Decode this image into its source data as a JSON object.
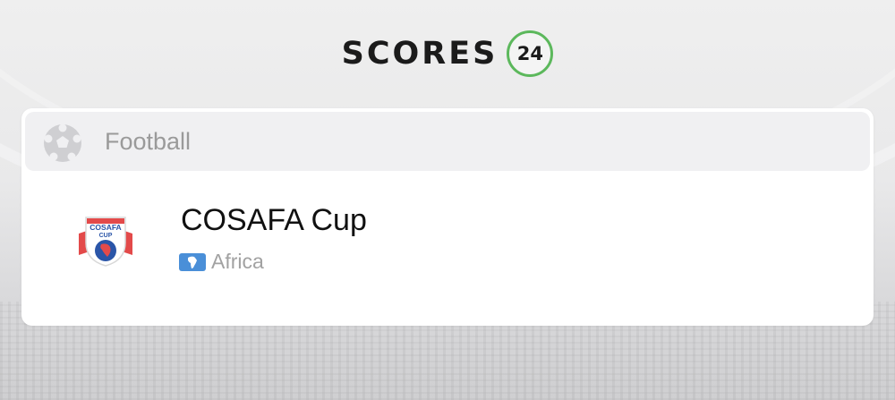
{
  "brand": {
    "wordmark": "SCORES",
    "number": "24",
    "accent_color": "#5cb85c"
  },
  "sport": {
    "label": "Football",
    "icon": "soccer-ball-icon"
  },
  "tournament": {
    "name": "COSAFA Cup",
    "logo_icon": "cosafa-cup-logo",
    "logo_text_line1": "COSAFA",
    "logo_text_line2": "CUP",
    "region_label": "Africa",
    "region_icon": "africa-map-icon",
    "region_color": "#4a8fd8"
  }
}
